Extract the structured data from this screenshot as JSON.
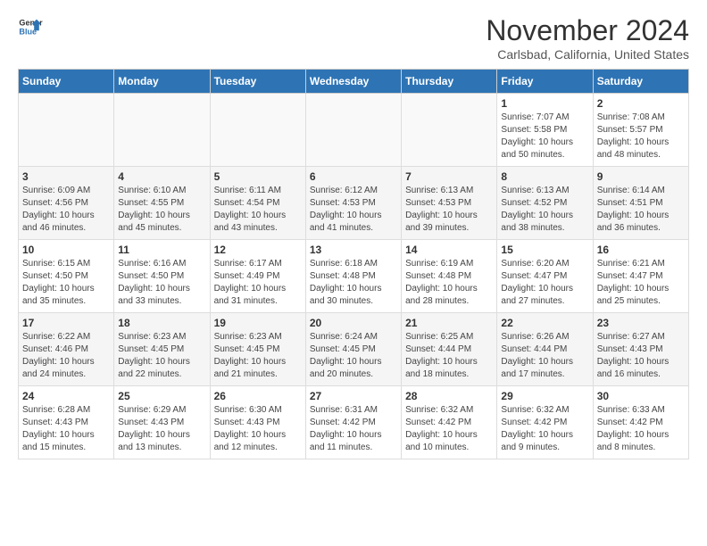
{
  "logo": {
    "line1": "General",
    "line2": "Blue"
  },
  "title": "November 2024",
  "location": "Carlsbad, California, United States",
  "weekdays": [
    "Sunday",
    "Monday",
    "Tuesday",
    "Wednesday",
    "Thursday",
    "Friday",
    "Saturday"
  ],
  "weeks": [
    [
      {
        "day": "",
        "info": ""
      },
      {
        "day": "",
        "info": ""
      },
      {
        "day": "",
        "info": ""
      },
      {
        "day": "",
        "info": ""
      },
      {
        "day": "",
        "info": ""
      },
      {
        "day": "1",
        "info": "Sunrise: 7:07 AM\nSunset: 5:58 PM\nDaylight: 10 hours and 50 minutes."
      },
      {
        "day": "2",
        "info": "Sunrise: 7:08 AM\nSunset: 5:57 PM\nDaylight: 10 hours and 48 minutes."
      }
    ],
    [
      {
        "day": "3",
        "info": "Sunrise: 6:09 AM\nSunset: 4:56 PM\nDaylight: 10 hours and 46 minutes."
      },
      {
        "day": "4",
        "info": "Sunrise: 6:10 AM\nSunset: 4:55 PM\nDaylight: 10 hours and 45 minutes."
      },
      {
        "day": "5",
        "info": "Sunrise: 6:11 AM\nSunset: 4:54 PM\nDaylight: 10 hours and 43 minutes."
      },
      {
        "day": "6",
        "info": "Sunrise: 6:12 AM\nSunset: 4:53 PM\nDaylight: 10 hours and 41 minutes."
      },
      {
        "day": "7",
        "info": "Sunrise: 6:13 AM\nSunset: 4:53 PM\nDaylight: 10 hours and 39 minutes."
      },
      {
        "day": "8",
        "info": "Sunrise: 6:13 AM\nSunset: 4:52 PM\nDaylight: 10 hours and 38 minutes."
      },
      {
        "day": "9",
        "info": "Sunrise: 6:14 AM\nSunset: 4:51 PM\nDaylight: 10 hours and 36 minutes."
      }
    ],
    [
      {
        "day": "10",
        "info": "Sunrise: 6:15 AM\nSunset: 4:50 PM\nDaylight: 10 hours and 35 minutes."
      },
      {
        "day": "11",
        "info": "Sunrise: 6:16 AM\nSunset: 4:50 PM\nDaylight: 10 hours and 33 minutes."
      },
      {
        "day": "12",
        "info": "Sunrise: 6:17 AM\nSunset: 4:49 PM\nDaylight: 10 hours and 31 minutes."
      },
      {
        "day": "13",
        "info": "Sunrise: 6:18 AM\nSunset: 4:48 PM\nDaylight: 10 hours and 30 minutes."
      },
      {
        "day": "14",
        "info": "Sunrise: 6:19 AM\nSunset: 4:48 PM\nDaylight: 10 hours and 28 minutes."
      },
      {
        "day": "15",
        "info": "Sunrise: 6:20 AM\nSunset: 4:47 PM\nDaylight: 10 hours and 27 minutes."
      },
      {
        "day": "16",
        "info": "Sunrise: 6:21 AM\nSunset: 4:47 PM\nDaylight: 10 hours and 25 minutes."
      }
    ],
    [
      {
        "day": "17",
        "info": "Sunrise: 6:22 AM\nSunset: 4:46 PM\nDaylight: 10 hours and 24 minutes."
      },
      {
        "day": "18",
        "info": "Sunrise: 6:23 AM\nSunset: 4:45 PM\nDaylight: 10 hours and 22 minutes."
      },
      {
        "day": "19",
        "info": "Sunrise: 6:23 AM\nSunset: 4:45 PM\nDaylight: 10 hours and 21 minutes."
      },
      {
        "day": "20",
        "info": "Sunrise: 6:24 AM\nSunset: 4:45 PM\nDaylight: 10 hours and 20 minutes."
      },
      {
        "day": "21",
        "info": "Sunrise: 6:25 AM\nSunset: 4:44 PM\nDaylight: 10 hours and 18 minutes."
      },
      {
        "day": "22",
        "info": "Sunrise: 6:26 AM\nSunset: 4:44 PM\nDaylight: 10 hours and 17 minutes."
      },
      {
        "day": "23",
        "info": "Sunrise: 6:27 AM\nSunset: 4:43 PM\nDaylight: 10 hours and 16 minutes."
      }
    ],
    [
      {
        "day": "24",
        "info": "Sunrise: 6:28 AM\nSunset: 4:43 PM\nDaylight: 10 hours and 15 minutes."
      },
      {
        "day": "25",
        "info": "Sunrise: 6:29 AM\nSunset: 4:43 PM\nDaylight: 10 hours and 13 minutes."
      },
      {
        "day": "26",
        "info": "Sunrise: 6:30 AM\nSunset: 4:43 PM\nDaylight: 10 hours and 12 minutes."
      },
      {
        "day": "27",
        "info": "Sunrise: 6:31 AM\nSunset: 4:42 PM\nDaylight: 10 hours and 11 minutes."
      },
      {
        "day": "28",
        "info": "Sunrise: 6:32 AM\nSunset: 4:42 PM\nDaylight: 10 hours and 10 minutes."
      },
      {
        "day": "29",
        "info": "Sunrise: 6:32 AM\nSunset: 4:42 PM\nDaylight: 10 hours and 9 minutes."
      },
      {
        "day": "30",
        "info": "Sunrise: 6:33 AM\nSunset: 4:42 PM\nDaylight: 10 hours and 8 minutes."
      }
    ]
  ]
}
